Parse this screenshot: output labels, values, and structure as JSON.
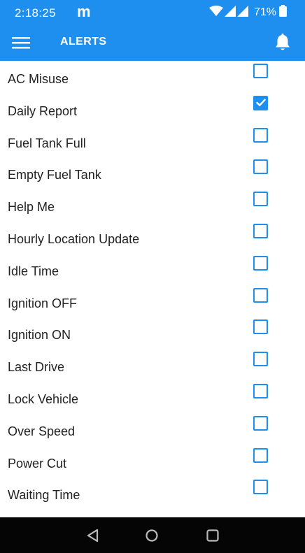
{
  "status_bar": {
    "time": "2:18:25",
    "carrier_glyph": "m",
    "battery_percent": "71%",
    "icons": [
      "wifi-icon",
      "signal-icon",
      "signal-icon",
      "battery-icon"
    ]
  },
  "app_bar": {
    "title": "ALERTS",
    "menu_icon": "hamburger-menu-icon",
    "notification_icon": "bell-icon"
  },
  "alerts": [
    {
      "label": "AC Misuse",
      "checked": false
    },
    {
      "label": "Daily Report",
      "checked": true
    },
    {
      "label": "Fuel Tank Full",
      "checked": false
    },
    {
      "label": "Empty Fuel Tank",
      "checked": false
    },
    {
      "label": "Help Me",
      "checked": false
    },
    {
      "label": "Hourly Location Update",
      "checked": false
    },
    {
      "label": "Idle Time",
      "checked": false
    },
    {
      "label": "Ignition OFF",
      "checked": false
    },
    {
      "label": "Ignition ON",
      "checked": false
    },
    {
      "label": "Last Drive",
      "checked": false
    },
    {
      "label": "Lock Vehicle",
      "checked": false
    },
    {
      "label": "Over Speed",
      "checked": false
    },
    {
      "label": "Power Cut",
      "checked": false
    },
    {
      "label": "Waiting Time",
      "checked": false
    }
  ],
  "nav_bar": {
    "buttons": [
      "back-icon",
      "home-icon",
      "recents-icon"
    ]
  },
  "colors": {
    "accent": "#1e8fee",
    "nav_background": "#050505",
    "text": "#222222"
  }
}
